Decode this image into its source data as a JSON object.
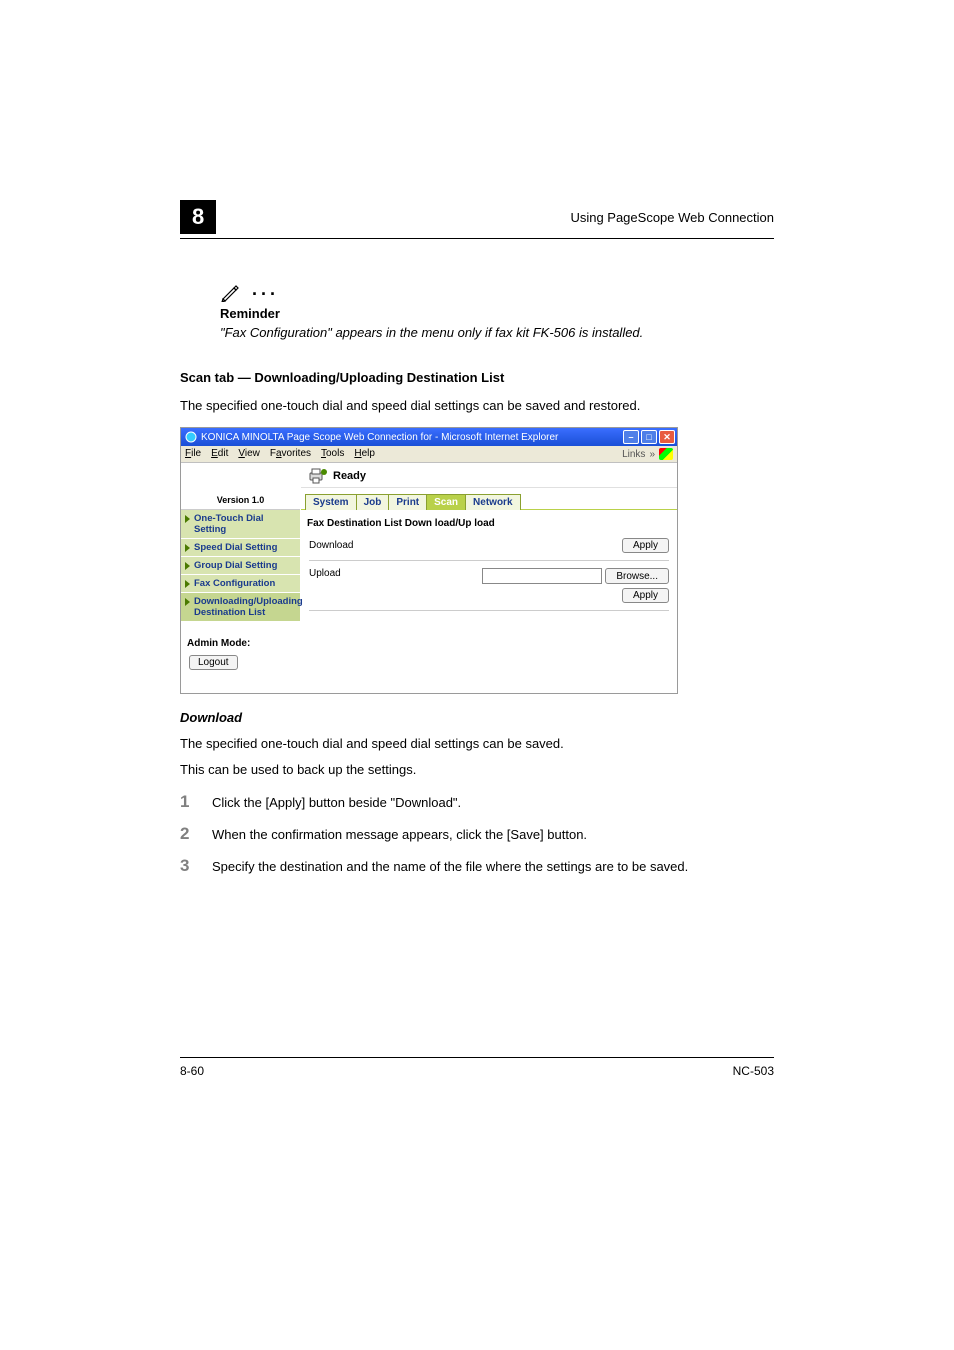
{
  "chapter": "8",
  "headerRight": "Using PageScope Web Connection",
  "reminder": {
    "title": "Reminder",
    "text": "\"Fax Configuration\" appears in the menu only if fax kit FK-506 is installed."
  },
  "sectionTitle": "Scan tab — Downloading/Uploading Destination List",
  "introText": "The specified one-touch dial and speed dial settings can be saved and restored.",
  "screenshot": {
    "windowTitle": "KONICA MINOLTA Page Scope Web Connection for        - Microsoft Internet Explorer",
    "menus": [
      "File",
      "Edit",
      "View",
      "Favorites",
      "Tools",
      "Help"
    ],
    "linksLabel": "Links",
    "status": "Ready",
    "version": "Version 1.0",
    "sidebar": [
      "One-Touch Dial Setting",
      "Speed Dial Setting",
      "Group Dial Setting",
      "Fax Configuration",
      "Downloading/Uploading Destination List"
    ],
    "adminMode": "Admin Mode:",
    "logout": "Logout",
    "tabs": {
      "system": "System",
      "job": "Job",
      "print": "Print",
      "scan": "Scan",
      "network": "Network"
    },
    "panelTitle": "Fax Destination List Down load/Up load",
    "downloadLabel": "Download",
    "uploadLabel": "Upload",
    "uploadValue": "",
    "browse": "Browse...",
    "apply": "Apply"
  },
  "download": {
    "heading": "Download",
    "p1": "The specified one-touch dial and speed dial settings can be saved.",
    "p2": "This can be used to back up the settings.",
    "steps": [
      "Click the [Apply] button beside \"Download\".",
      "When the confirmation message appears, click the [Save] button.",
      "Specify the destination and the name of the file where the settings are to be saved."
    ]
  },
  "footer": {
    "left": "8-60",
    "right": "NC-503"
  }
}
